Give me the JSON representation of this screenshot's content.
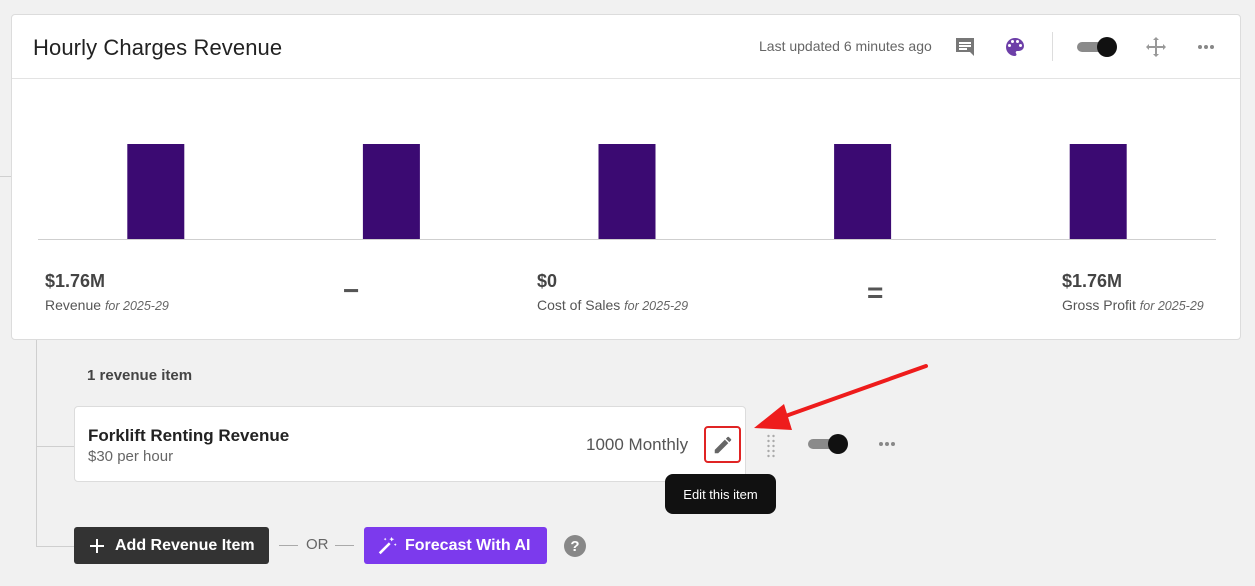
{
  "card": {
    "title": "Hourly Charges Revenue",
    "last_updated": "Last updated 6 minutes ago",
    "icons": [
      "comment-icon",
      "palette-icon",
      "toggle",
      "move-icon",
      "more-icon"
    ]
  },
  "chart_data": {
    "type": "bar",
    "categories": [
      "",
      "",
      "",
      "",
      ""
    ],
    "values": [
      1,
      1,
      1,
      1,
      1
    ],
    "bar_color": "#3b0a72",
    "grid": false
  },
  "summary": {
    "revenue": {
      "value": "$1.76M",
      "label": "Revenue",
      "period": "for 2025-29"
    },
    "minus": "−",
    "cost": {
      "value": "$0",
      "label": "Cost of Sales",
      "period": "for 2025-29"
    },
    "equals": "=",
    "gross": {
      "value": "$1.76M",
      "label": "Gross Profit",
      "period": "for 2025-29"
    }
  },
  "revenue_list": {
    "count_label": "1 revenue item",
    "items": [
      {
        "name": "Forklift Renting Revenue",
        "rate": "$30 per hour",
        "amount": "1000 Monthly"
      }
    ]
  },
  "tooltip": "Edit this item",
  "actions": {
    "add_label": "Add Revenue Item",
    "or_label": "OR",
    "ai_label": "Forecast With AI",
    "help": "?"
  },
  "colors": {
    "accent": "#7c3aed",
    "bar": "#3b0a72",
    "highlight": "#e02424",
    "dark_button": "#333333"
  }
}
